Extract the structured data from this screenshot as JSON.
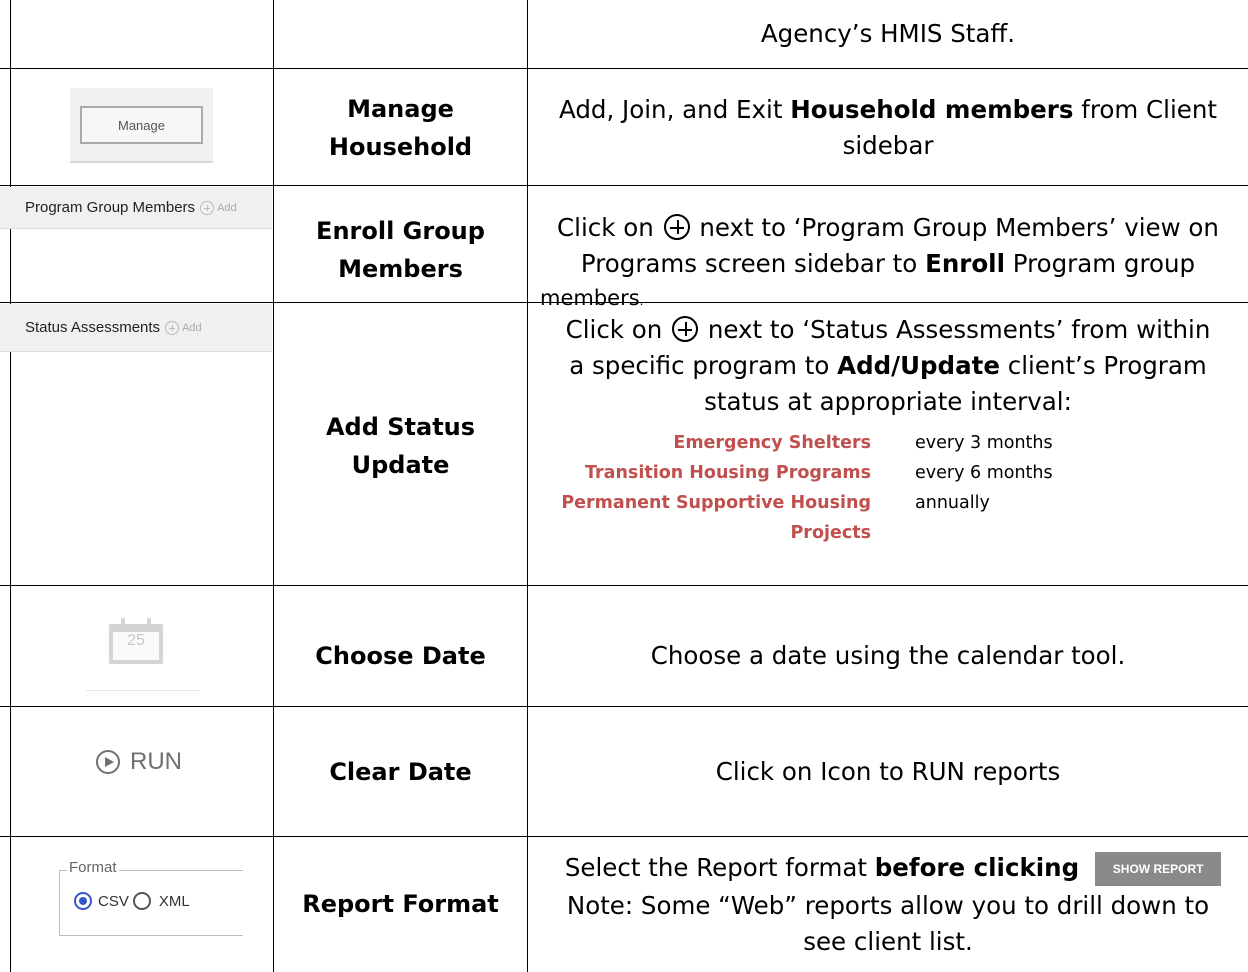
{
  "rows": [
    {
      "name": "",
      "description": "Agency’s HMIS Staff."
    },
    {
      "icon": {
        "button_label": "Manage"
      },
      "name_lines": [
        "Manage",
        "Household"
      ],
      "desc_parts": [
        "Add, Join, and Exit ",
        "Household members",
        " from Client",
        "sidebar"
      ]
    },
    {
      "icon": {
        "label": "Program Group Members",
        "add": "Add"
      },
      "name_lines": [
        "Enroll Group",
        "Members"
      ],
      "desc_parts": [
        "Click on ",
        " next to ‘Program Group Members’ view on",
        "Programs screen sidebar to ",
        "Enroll",
        " Program group",
        "members",
        "."
      ]
    },
    {
      "icon": {
        "label": "Status Assessments",
        "add": "Add"
      },
      "name_lines": [
        "Add Status",
        "Update"
      ],
      "desc_parts": [
        "Click on ",
        " next to ‘Status Assessments’ from within",
        "a specific program to ",
        "Add/Update",
        " client’s Program",
        "status at appropriate interval:"
      ],
      "intervals": [
        {
          "program": "Emergency Shelters",
          "frequency": "every 3 months"
        },
        {
          "program": "Transition Housing Programs",
          "frequency": "every 6 months"
        },
        {
          "program": "Permanent Supportive Housing",
          "program_line2": "Projects",
          "frequency": "annually"
        }
      ]
    },
    {
      "icon": {
        "day": "25",
        "icon_name": "calendar-icon"
      },
      "name": "Choose Date",
      "description": "Choose a date using the calendar tool."
    },
    {
      "icon": {
        "label": "RUN",
        "icon_name": "play-circle-icon"
      },
      "name": "Clear Date",
      "description": "Click on Icon to RUN reports"
    },
    {
      "icon": {
        "legend": "Format",
        "options": [
          "CSV",
          "XML"
        ],
        "selected": "CSV"
      },
      "name": "Report Format",
      "desc_parts": [
        "Select the Report format ",
        "before clicking",
        "Note: Some “Web” reports allow you to drill down to",
        "see client list."
      ],
      "button_label": "SHOW REPORT"
    }
  ],
  "colors": {
    "program_red": "#c0504d",
    "radio_blue": "#3656c8",
    "button_gray": "#8a8a8a"
  }
}
